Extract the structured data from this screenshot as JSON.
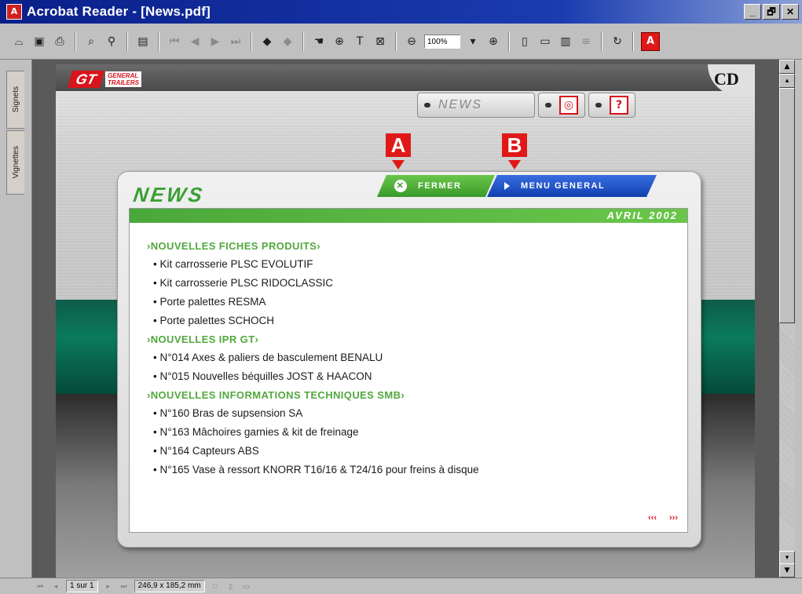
{
  "window": {
    "title": "Acrobat Reader - [News.pdf]",
    "app_icon": "A",
    "controls": [
      "_",
      "🗗",
      "✕"
    ]
  },
  "toolbar": {
    "zoom_value": "100%",
    "icons": [
      "open-icon",
      "save-icon",
      "print-icon",
      "find-icon",
      "search-icon",
      "thumbnail-icon",
      "first-page-icon",
      "prev-page-icon",
      "next-page-icon",
      "last-page-icon",
      "back-icon",
      "forward-icon",
      "hand-icon",
      "zoom-icon",
      "text-select-icon",
      "graphics-select-icon",
      "zoom-out-icon",
      "zoom-in-icon",
      "actual-size-icon",
      "fit-page-icon",
      "fit-width-icon",
      "reflow-icon",
      "rotate-icon",
      "acrobat-icon"
    ]
  },
  "sidebar": {
    "tabs": [
      {
        "label": "Signets"
      },
      {
        "label": "Vignettes"
      }
    ]
  },
  "page": {
    "brand_mark": "GT",
    "brand_line1": "GENERAL",
    "brand_line2": "TRAILERS",
    "cd_label": "CD",
    "topnav": {
      "news_label": "NEWS",
      "icon2": "◎",
      "icon3": "?"
    },
    "callouts": [
      {
        "label": "A"
      },
      {
        "label": "B"
      }
    ],
    "panel": {
      "title": "NEWS",
      "fermer_label": "FERMER",
      "menu_label": "MENU GENERAL",
      "date": "AVRIL 2002",
      "sections": [
        {
          "title": "›NOUVELLES FICHES PRODUITS›",
          "items": [
            "• Kit carrosserie PLSC EVOLUTIF",
            "• Kit carrosserie PLSC RIDOCLASSIC",
            "• Porte palettes RESMA",
            "• Porte palettes SCHOCH"
          ]
        },
        {
          "title": "›NOUVELLES IPR GT›",
          "items": [
            "• N°014 Axes & paliers de basculement BENALU",
            "• N°015 Nouvelles béquilles JOST & HAACON"
          ]
        },
        {
          "title": "›NOUVELLES INFORMATIONS TECHNIQUES SMB›",
          "items": [
            "• N°160 Bras de supsension SA",
            "• N°163 Mâchoires garnies & kit de freinage",
            "• N°164 Capteurs ABS",
            "• N°165 Vase à ressort KNORR T16/16 & T24/16 pour freins à disque"
          ]
        }
      ],
      "pager_prev": "‹‹‹",
      "pager_next": "›››"
    }
  },
  "statusbar": {
    "page_indicator": "1 sur 1",
    "page_size": "246,9 x 185,2 mm"
  }
}
